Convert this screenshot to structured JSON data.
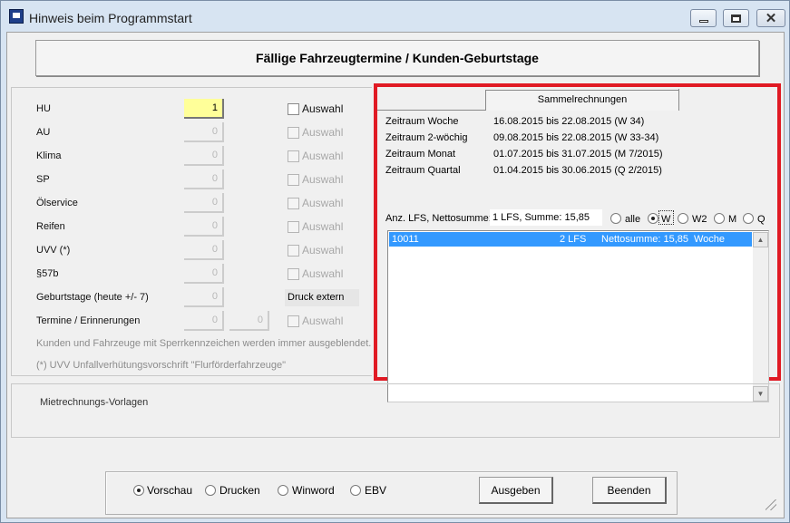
{
  "window": {
    "title": "Hinweis beim Programmstart"
  },
  "banner": "Fällige Fahrzeugtermine / Kunden-Geburtstage",
  "rows": [
    {
      "label": "HU",
      "value": "1",
      "check_label": "Auswahl"
    },
    {
      "label": "AU",
      "value": "0",
      "check_label": "Auswahl"
    },
    {
      "label": "Klima",
      "value": "0",
      "check_label": "Auswahl"
    },
    {
      "label": "SP",
      "value": "0",
      "check_label": "Auswahl"
    },
    {
      "label": "Ölservice",
      "value": "0",
      "check_label": "Auswahl"
    },
    {
      "label": "Reifen",
      "value": "0",
      "check_label": "Auswahl"
    },
    {
      "label": "UVV (*)",
      "value": "0",
      "check_label": "Auswahl"
    },
    {
      "label": "§57b",
      "value": "0",
      "check_label": "Auswahl"
    },
    {
      "label": "Geburtstage (heute +/- 7)",
      "value": "0",
      "extra_label": "Druck extern"
    },
    {
      "label": "Termine / Erinnerungen",
      "value": "0",
      "value2": "0",
      "check_label": "Auswahl"
    }
  ],
  "notes": {
    "sperr": "Kunden und Fahrzeuge mit Sperrkennzeichen werden immer ausgeblendet.",
    "uvv": "(*) UVV Unfallverhütungsvorschrift \"Flurförderfahrzeuge\""
  },
  "sammel": {
    "tab": "Sammelrechnungen",
    "zeitraum": [
      {
        "label": "Zeitraum Woche",
        "value": "16.08.2015 bis 22.08.2015 (W 34)"
      },
      {
        "label": "Zeitraum 2-wöchig",
        "value": "09.08.2015 bis 22.08.2015 (W 33-34)"
      },
      {
        "label": "Zeitraum Monat",
        "value": "01.07.2015 bis 31.07.2015 (M 7/2015)"
      },
      {
        "label": "Zeitraum Quartal",
        "value": "01.04.2015 bis 30.06.2015 (Q 2/2015)"
      }
    ],
    "anz_label": "Anz. LFS, Nettosumme:",
    "anz_value": "1 LFS, Summe: 15,85",
    "filters": [
      "alle",
      "W",
      "W2",
      "M",
      "Q"
    ],
    "selected_filter": "W",
    "list": [
      {
        "nr": "10011",
        "lfs": "2 LFS",
        "netto": "Nettosumme: 15,85",
        "period": "Woche"
      }
    ]
  },
  "miet_label": "Mietrechnungs-Vorlagen",
  "output": {
    "options": [
      "Vorschau",
      "Drucken",
      "Winword",
      "EBV"
    ],
    "selected": "Vorschau",
    "ausgeben": "Ausgeben",
    "beenden": "Beenden"
  }
}
